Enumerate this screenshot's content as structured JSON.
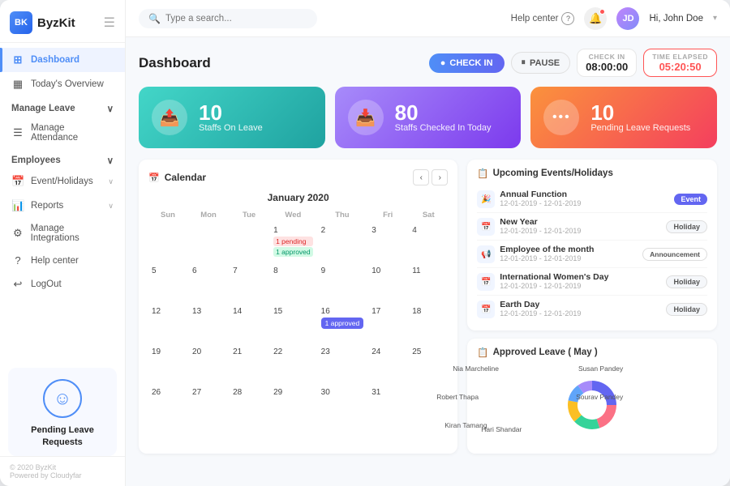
{
  "app": {
    "name": "ByzKit",
    "logo_letter": "B"
  },
  "topbar": {
    "search_placeholder": "Type a search...",
    "help_label": "Help center",
    "user_name": "Hi, John Doe",
    "avatar_initials": "JD"
  },
  "sidebar": {
    "items": [
      {
        "id": "dashboard",
        "label": "Dashboard",
        "icon": "⊞",
        "active": true
      },
      {
        "id": "todays-overview",
        "label": "Today's Overview",
        "icon": "▦",
        "active": false
      }
    ],
    "sections": [
      {
        "label": "Manage Leave",
        "items": [
          {
            "id": "manage-attendance",
            "label": "Manage Attendance",
            "icon": "☰"
          }
        ]
      },
      {
        "label": "Employees",
        "items": [
          {
            "id": "events-holidays",
            "label": "Event/Holidays",
            "icon": "📅"
          },
          {
            "id": "reports",
            "label": "Reports",
            "icon": "📊"
          },
          {
            "id": "manage-integrations",
            "label": "Manage Integrations",
            "icon": "⚙"
          },
          {
            "id": "help-center",
            "label": "Help center",
            "icon": "?"
          },
          {
            "id": "logout",
            "label": "LogOut",
            "icon": "↩"
          }
        ]
      }
    ],
    "pending_label": "Pending Leave Requests",
    "footer": "© 2020 ByzKit\nPowered by Cloudyfar"
  },
  "page_title": "Dashboard",
  "header_actions": {
    "checkin_label": "CHECK IN",
    "pause_label": "PAUSE",
    "checkin_time_label": "CHECK IN",
    "checkin_time_value": "08:00:00",
    "elapsed_label": "TIME ELAPSED",
    "elapsed_value": "05:20:50"
  },
  "stat_cards": [
    {
      "id": "staffs-on-leave",
      "number": "10",
      "label": "Staffs On Leave",
      "theme": "teal",
      "icon": "📤"
    },
    {
      "id": "staffs-checked-in",
      "number": "80",
      "label": "Staffs Checked In Today",
      "theme": "purple",
      "icon": "📥"
    },
    {
      "id": "pending-leave",
      "number": "10",
      "label": "Pending Leave Requests",
      "theme": "orange",
      "icon": "···"
    }
  ],
  "calendar": {
    "title": "Calendar",
    "month": "January 2020",
    "day_names": [
      "Sun",
      "Mon",
      "Tue",
      "Wed",
      "Thu",
      "Fri",
      "Sat"
    ],
    "weeks": [
      [
        {
          "day": "",
          "other": true
        },
        {
          "day": "",
          "other": true
        },
        {
          "day": "",
          "other": true
        },
        {
          "day": "1",
          "events": [
            {
              "type": "pending",
              "label": "1 pending"
            },
            {
              "type": "approved",
              "label": "1 approved"
            }
          ]
        },
        {
          "day": "2"
        },
        {
          "day": "3"
        },
        {
          "day": "4"
        }
      ],
      [
        {
          "day": "5"
        },
        {
          "day": "6"
        },
        {
          "day": "7"
        },
        {
          "day": "8"
        },
        {
          "day": "9"
        },
        {
          "day": "10"
        },
        {
          "day": "11"
        }
      ],
      [
        {
          "day": "12"
        },
        {
          "day": "13"
        },
        {
          "day": "14"
        },
        {
          "day": "15"
        },
        {
          "day": "16",
          "events": [
            {
              "type": "blue-bar",
              "label": "1 approved"
            }
          ]
        },
        {
          "day": "17"
        },
        {
          "day": "18"
        }
      ],
      [
        {
          "day": "19"
        },
        {
          "day": "20"
        },
        {
          "day": "21"
        },
        {
          "day": "22"
        },
        {
          "day": "23"
        },
        {
          "day": "24"
        },
        {
          "day": "25"
        }
      ],
      [
        {
          "day": "26"
        },
        {
          "day": "27"
        },
        {
          "day": "28"
        },
        {
          "day": "29"
        },
        {
          "day": "30"
        },
        {
          "day": "31"
        },
        {
          "day": "",
          "other": true
        }
      ]
    ]
  },
  "upcoming_events": {
    "title": "Upcoming Events/Holidays",
    "events": [
      {
        "name": "Annual Function",
        "date": "12-01-2019 - 12-01-2019",
        "badge": "Event",
        "badge_type": "event"
      },
      {
        "name": "New Year",
        "date": "12-01-2019 - 12-01-2019",
        "badge": "Holiday",
        "badge_type": "holiday"
      },
      {
        "name": "Employee of the month",
        "date": "12-01-2019 - 12-01-2019",
        "badge": "Announcement",
        "badge_type": "announcement"
      },
      {
        "name": "International Women's Day",
        "date": "12-01-2019 - 12-01-2019",
        "badge": "Holiday",
        "badge_type": "holiday"
      },
      {
        "name": "Earth Day",
        "date": "12-01-2019 - 12-01-2019",
        "badge": "Holiday",
        "badge_type": "holiday"
      }
    ]
  },
  "approved_leave": {
    "title": "Approved Leave ( May )",
    "donut": {
      "segments": [
        {
          "name": "Nia Marcheline",
          "color": "#6366f1",
          "percent": 25
        },
        {
          "name": "Susan Pandey",
          "color": "#fb7185",
          "percent": 20
        },
        {
          "name": "Robert Thapa",
          "color": "#34d399",
          "percent": 18
        },
        {
          "name": "Sourav Pandey",
          "color": "#fbbf24",
          "percent": 15
        },
        {
          "name": "Kiran Tamang",
          "color": "#60a5fa",
          "percent": 12
        },
        {
          "name": "Hari Shandar",
          "color": "#a78bfa",
          "percent": 10
        }
      ]
    }
  }
}
